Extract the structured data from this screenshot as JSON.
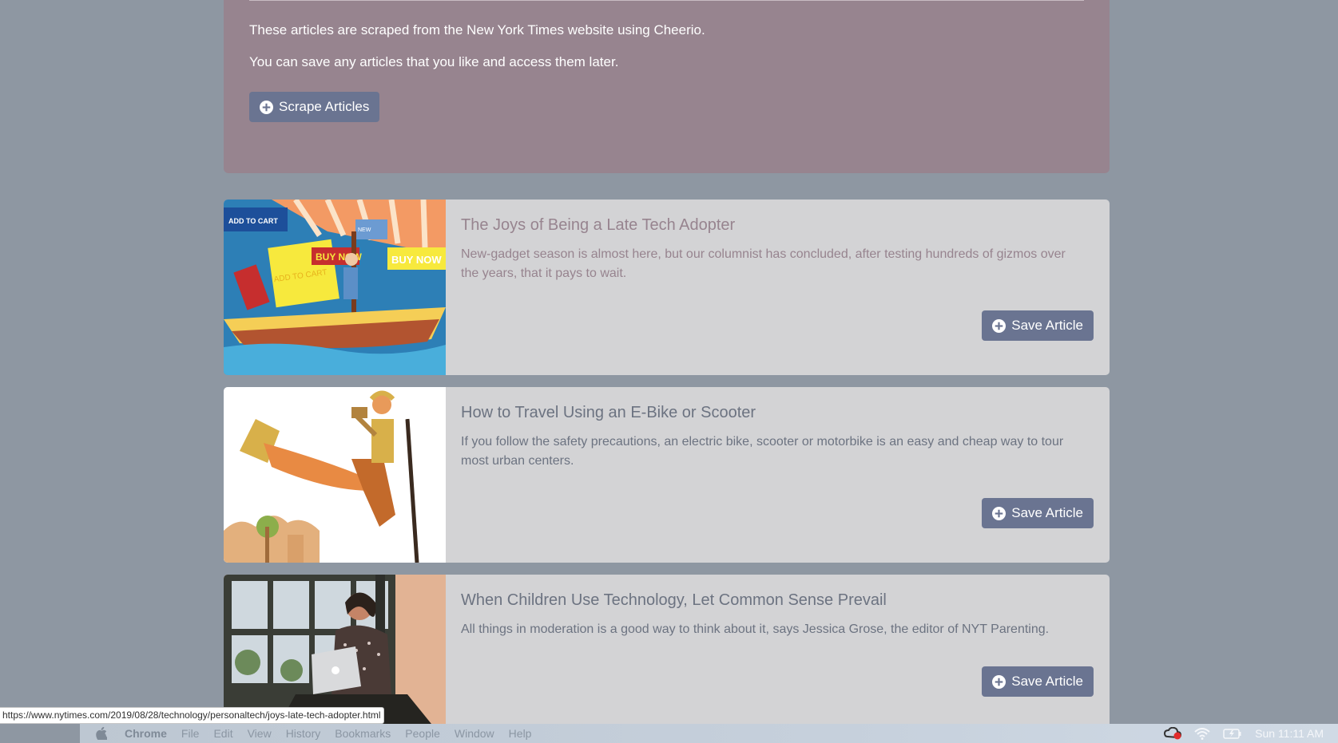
{
  "jumbotron": {
    "line1": "These articles are scraped from the New York Times website using Cheerio.",
    "line2": "You can save any articles that you like and access them later.",
    "scrape_button": "Scrape Articles"
  },
  "articles": [
    {
      "title": "The Joys of Being a Late Tech Adopter",
      "summary": "New-gadget season is almost here, but our columnist has concluded, after testing hundreds of gizmos over the years, that it pays to wait.",
      "save_label": "Save Article",
      "image_text": [
        "ADD TO CART",
        "BUY NOW",
        "BUY NOW",
        "ADD TO CART",
        "NEW"
      ]
    },
    {
      "title": "How to Travel Using an E-Bike or Scooter",
      "summary": "If you follow the safety precautions, an electric bike, scooter or motorbike is an easy and cheap way to tour most urban centers.",
      "save_label": "Save Article"
    },
    {
      "title": "When Children Use Technology, Let Common Sense Prevail",
      "summary": "All things in moderation is a good way to think about it, says Jessica Grose, the editor of NYT Parenting.",
      "save_label": "Save Article"
    }
  ],
  "status_url": "https://www.nytimes.com/2019/08/28/technology/personaltech/joys-late-tech-adopter.html",
  "menubar": {
    "app": "Chrome",
    "items": [
      "File",
      "Edit",
      "View",
      "History",
      "Bookmarks",
      "People",
      "Window",
      "Help"
    ],
    "clock": "Sun 11:11 AM"
  },
  "colors": {
    "page_bg": "#8e97a2",
    "jumbotron_bg": "#97848f",
    "card_bg": "#d3d3d5",
    "button_bg": "#6a7491",
    "accent_title": "#97848f"
  }
}
